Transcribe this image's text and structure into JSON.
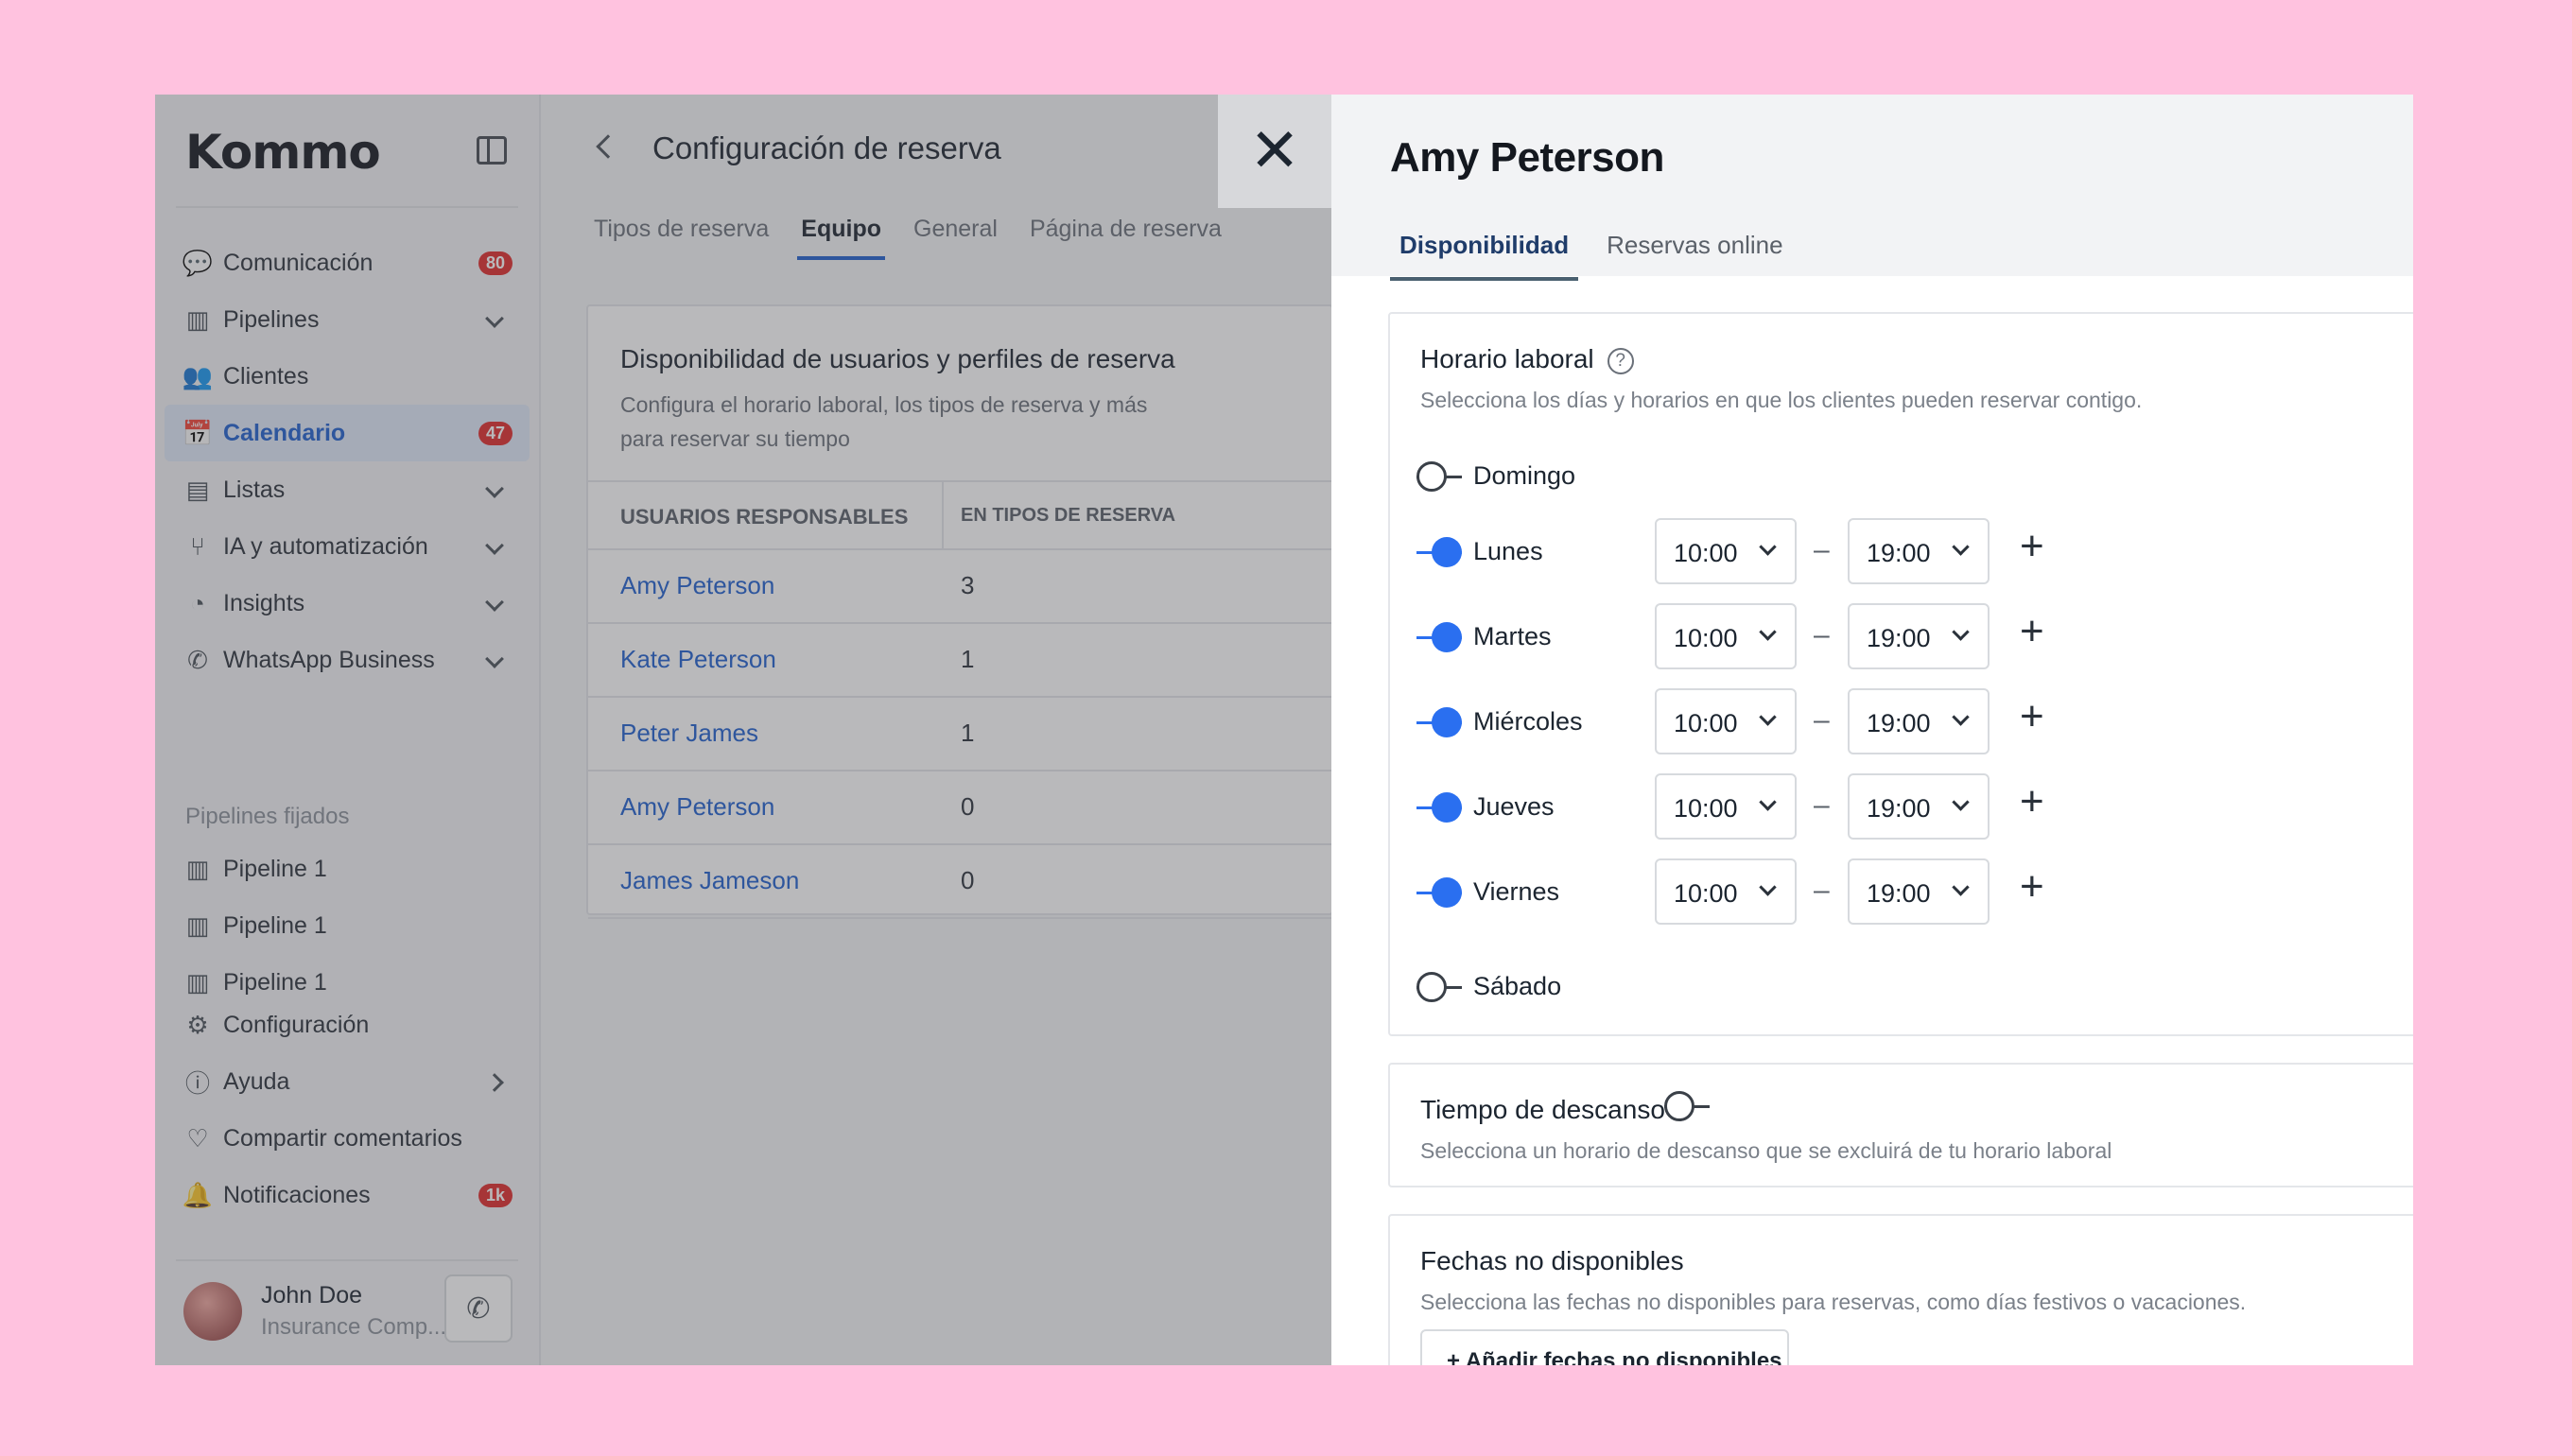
{
  "sidebar": {
    "logo": "Kommo",
    "nav": [
      {
        "label": "Comunicación",
        "icon": "chat-icon",
        "badge": "80"
      },
      {
        "label": "Pipelines",
        "icon": "pipeline-icon"
      },
      {
        "label": "Clientes",
        "icon": "users-icon"
      },
      {
        "label": "Calendario",
        "icon": "calendar-icon",
        "badge": "47",
        "active": true
      },
      {
        "label": "Listas",
        "icon": "list-icon"
      },
      {
        "label": "IA y automatización",
        "icon": "automation-icon"
      },
      {
        "label": "Insights",
        "icon": "chart-icon"
      },
      {
        "label": "WhatsApp Business",
        "icon": "whatsapp-icon"
      }
    ],
    "pinned_section": "Pipelines fijados",
    "pinned": [
      "Pipeline 1",
      "Pipeline 1",
      "Pipeline 1"
    ],
    "bottom": [
      {
        "label": "Configuración",
        "icon": "gear-icon"
      },
      {
        "label": "Ayuda",
        "icon": "help-icon"
      },
      {
        "label": "Compartir comentarios",
        "icon": "heart-icon"
      },
      {
        "label": "Notificaciones",
        "icon": "bell-icon",
        "badge": "1k"
      }
    ],
    "user": {
      "name": "John Doe",
      "company": "Insurance Comp..."
    }
  },
  "middle": {
    "title": "Configuración de reserva",
    "tabs": [
      "Tipos de reserva",
      "Equipo",
      "General",
      "Página de reserva"
    ],
    "active_tab": "Equipo",
    "card": {
      "title": "Disponibilidad de usuarios y perfiles de reserva",
      "description": "Configura el horario laboral, los tipos de reserva y más para reservar su tiempo",
      "col1": "USUARIOS RESPONSABLES",
      "col2": "EN TIPOS DE RESERVA",
      "rows": [
        {
          "name": "Amy Peterson",
          "count": "3"
        },
        {
          "name": "Kate Peterson",
          "count": "1"
        },
        {
          "name": "Peter James",
          "count": "1"
        },
        {
          "name": "Amy Peterson",
          "count": "0"
        },
        {
          "name": "James Jameson",
          "count": "0"
        }
      ]
    }
  },
  "panel": {
    "title": "Amy Peterson",
    "tabs": [
      "Disponibilidad",
      "Reservas online"
    ],
    "active_tab": "Disponibilidad",
    "working_hours": {
      "title": "Horario laboral",
      "description": "Selecciona los días y horarios en que los clientes pueden reservar contigo.",
      "days": [
        {
          "day": "Domingo",
          "enabled": false
        },
        {
          "day": "Lunes",
          "enabled": true,
          "from": "10:00",
          "to": "19:00"
        },
        {
          "day": "Martes",
          "enabled": true,
          "from": "10:00",
          "to": "19:00"
        },
        {
          "day": "Miércoles",
          "enabled": true,
          "from": "10:00",
          "to": "19:00"
        },
        {
          "day": "Jueves",
          "enabled": true,
          "from": "10:00",
          "to": "19:00"
        },
        {
          "day": "Viernes",
          "enabled": true,
          "from": "10:00",
          "to": "19:00"
        },
        {
          "day": "Sábado",
          "enabled": false
        }
      ],
      "separator": "–",
      "add_symbol": "+"
    },
    "break_time": {
      "title": "Tiempo de descanso",
      "description": "Selecciona un horario de descanso que se excluirá de tu horario laboral",
      "enabled": false
    },
    "unavailable": {
      "title": "Fechas no disponibles",
      "description": "Selecciona las fechas no disponibles para reservas, como días festivos o vacaciones.",
      "add_button": "+ Añadir fechas no disponibles"
    }
  },
  "colors": {
    "accent": "#2a6ff0",
    "badge": "#e02b2b",
    "background": "#ffc2df"
  }
}
